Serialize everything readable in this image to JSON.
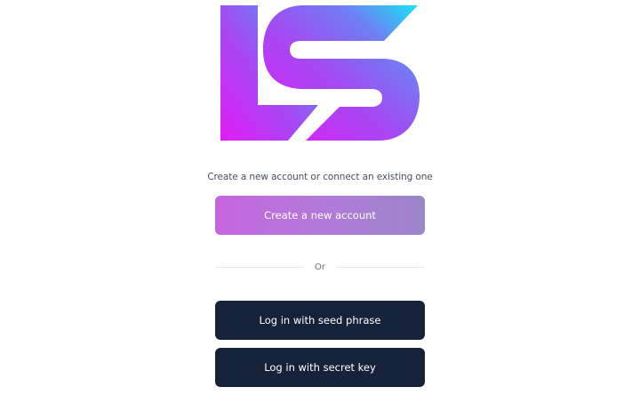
{
  "logo": {
    "name": "LS logo"
  },
  "subtitle": "Create a new account or connect an existing one",
  "buttons": {
    "create": "Create a new account",
    "seed": "Log in with seed phrase",
    "secret": "Log in with secret key"
  },
  "divider": {
    "label": "Or"
  },
  "colors": {
    "dark_button": "#16223a",
    "gradient_start": "#e21cf5",
    "gradient_end": "#14e6f6"
  }
}
